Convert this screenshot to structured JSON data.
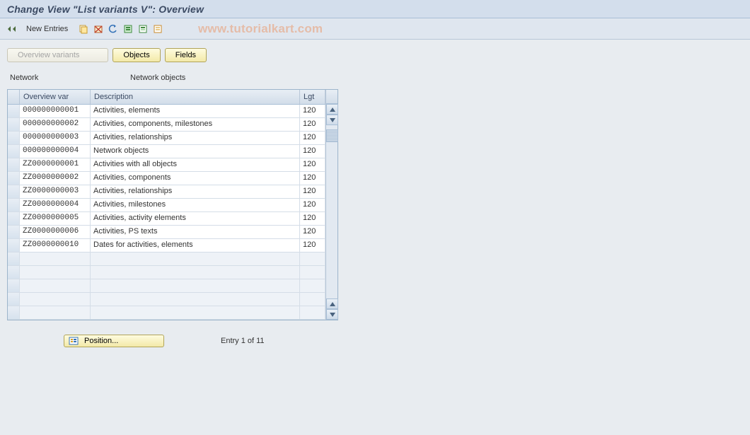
{
  "title": "Change View \"List variants                    V\": Overview",
  "toolbar": {
    "new_entries_label": "New Entries"
  },
  "watermark": "www.tutorialkart.com",
  "subtoolbar": {
    "overview_label": "Overview variants",
    "objects_label": "Objects",
    "fields_label": "Fields"
  },
  "labels": {
    "network": "Network",
    "network_objects": "Network objects"
  },
  "table": {
    "headers": {
      "overview_var": "Overview var",
      "description": "Description",
      "lgt": "Lgt"
    },
    "rows": [
      {
        "var": "000000000001",
        "desc": "Activities, elements",
        "lgt": "120"
      },
      {
        "var": "000000000002",
        "desc": "Activities, components, milestones",
        "lgt": "120"
      },
      {
        "var": "000000000003",
        "desc": "Activities, relationships",
        "lgt": "120"
      },
      {
        "var": "000000000004",
        "desc": "Network objects",
        "lgt": "120"
      },
      {
        "var": "ZZ0000000001",
        "desc": "Activities with all objects",
        "lgt": "120"
      },
      {
        "var": "ZZ0000000002",
        "desc": "Activities, components",
        "lgt": "120"
      },
      {
        "var": "ZZ0000000003",
        "desc": "Activities, relationships",
        "lgt": "120"
      },
      {
        "var": "ZZ0000000004",
        "desc": "Activities, milestones",
        "lgt": "120"
      },
      {
        "var": "ZZ0000000005",
        "desc": "Activities, activity elements",
        "lgt": "120"
      },
      {
        "var": "ZZ0000000006",
        "desc": "Activities, PS texts",
        "lgt": "120"
      },
      {
        "var": "ZZ0000000010",
        "desc": "Dates for activities, elements",
        "lgt": "120"
      }
    ],
    "empty_rows": 5
  },
  "footer": {
    "position_label": "Position...",
    "entry_label": "Entry 1 of 11"
  }
}
